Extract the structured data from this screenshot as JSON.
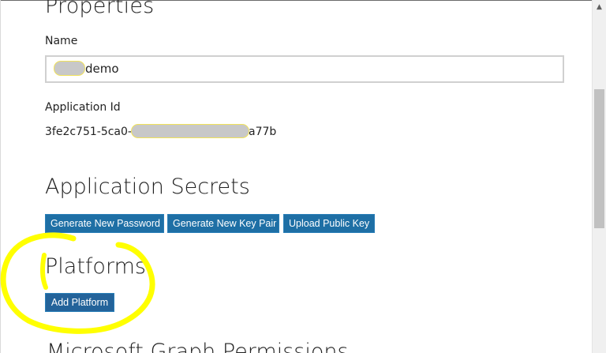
{
  "sections": {
    "properties": {
      "title": "Properties",
      "name_label": "Name",
      "name_value_suffix": "demo",
      "app_id_label": "Application Id",
      "app_id_prefix": "3fe2c751-5ca0-",
      "app_id_suffix": "a77b"
    },
    "secrets": {
      "title": "Application Secrets",
      "buttons": {
        "generate_password": "Generate New Password",
        "generate_key_pair": "Generate New Key Pair",
        "upload_public_key": "Upload Public Key"
      }
    },
    "platforms": {
      "title": "Platforms",
      "add_platform": "Add Platform"
    },
    "next_section": {
      "title": "Microsoft Graph Permissions"
    }
  },
  "colors": {
    "button_blue": "#1e6fa5",
    "annotation_yellow": "#ffff00",
    "redaction_gray": "#c8c8c8"
  },
  "icons": {
    "scroll_up": "up-arrow-icon"
  }
}
